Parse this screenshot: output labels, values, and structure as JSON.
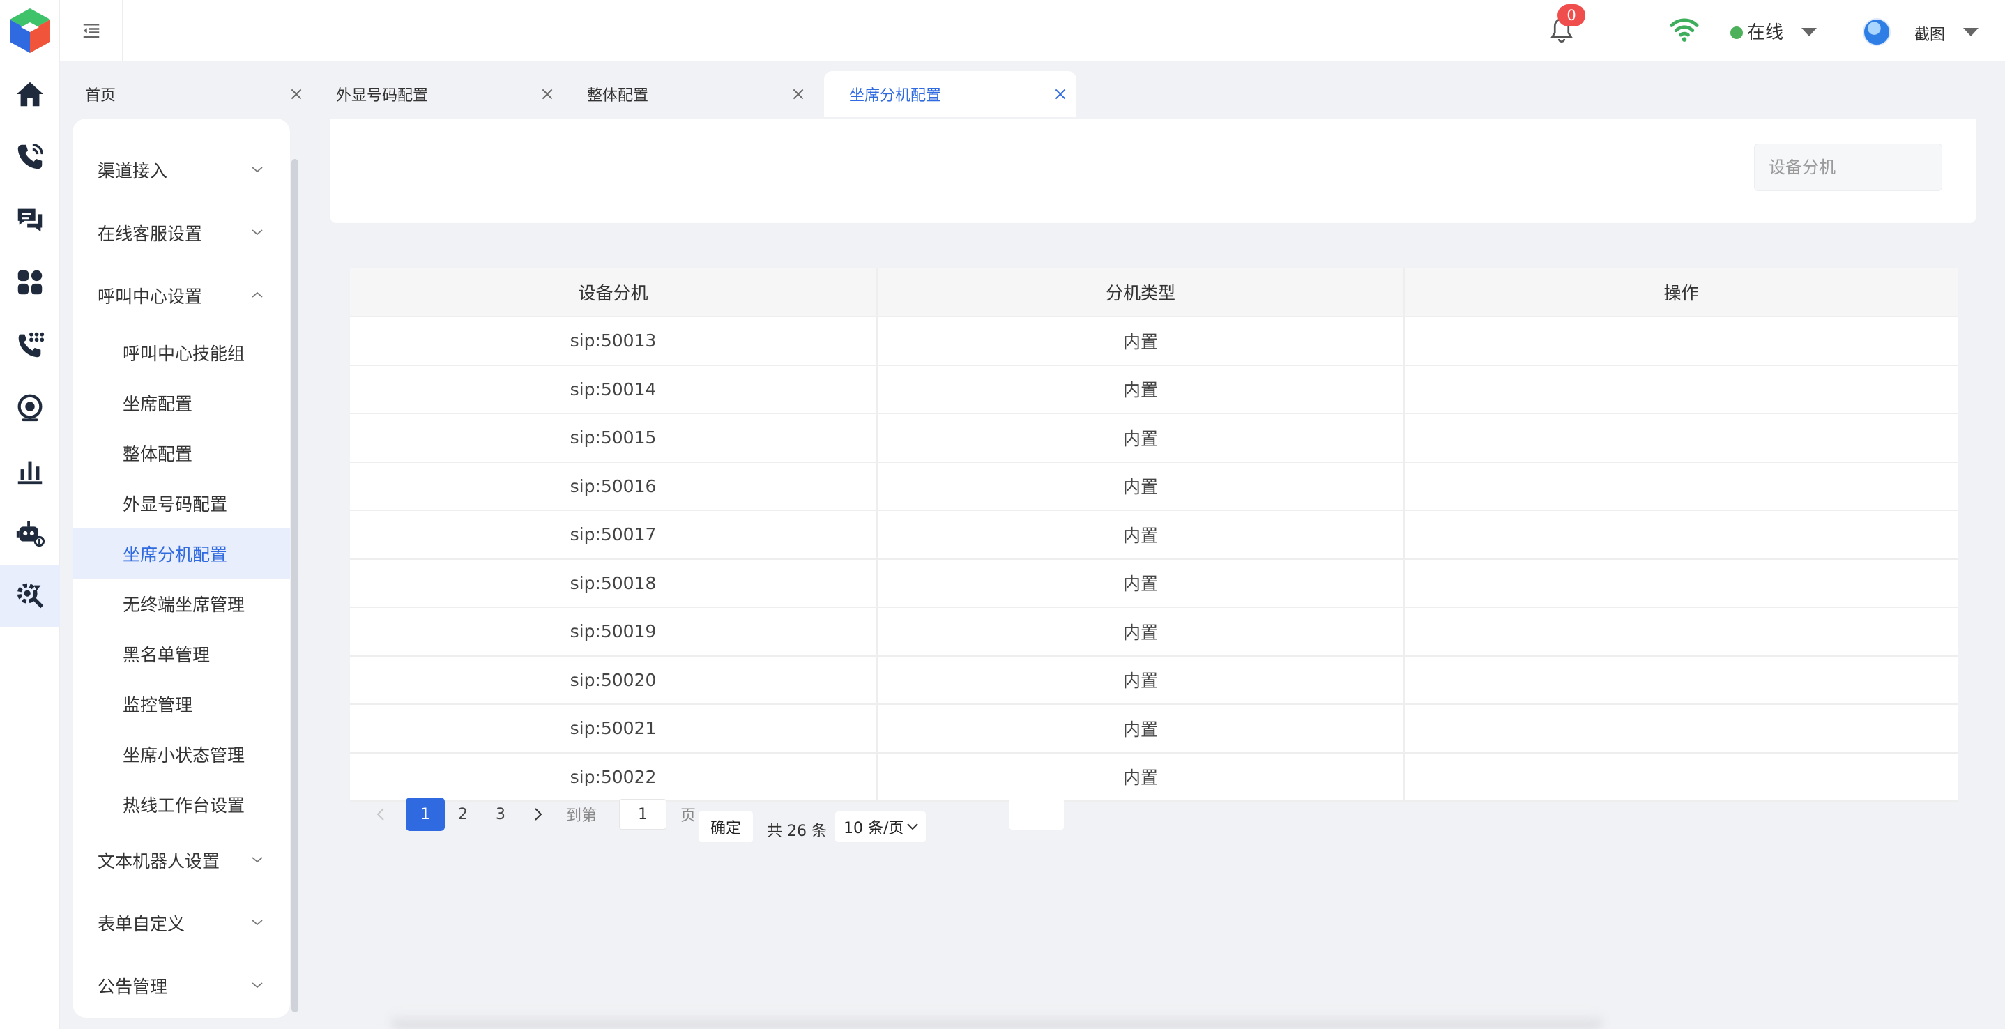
{
  "header": {
    "notification_count": "0",
    "status_label": "在线",
    "user_label": "截图"
  },
  "tabs": [
    {
      "label": "首页"
    },
    {
      "label": "外显号码配置"
    },
    {
      "label": "整体配置"
    },
    {
      "label": "坐席分机配置"
    }
  ],
  "menu": {
    "groups_top": [
      {
        "label": "渠道接入"
      },
      {
        "label": "在线客服设置"
      },
      {
        "label": "呼叫中心设置"
      }
    ],
    "sub_items": [
      {
        "label": "呼叫中心技能组"
      },
      {
        "label": "坐席配置"
      },
      {
        "label": "整体配置"
      },
      {
        "label": "外显号码配置"
      },
      {
        "label": "坐席分机配置"
      },
      {
        "label": "无终端坐席管理"
      },
      {
        "label": "黑名单管理"
      },
      {
        "label": "监控管理"
      },
      {
        "label": "坐席小状态管理"
      },
      {
        "label": "热线工作台设置"
      }
    ],
    "groups_bottom": [
      {
        "label": "文本机器人设置"
      },
      {
        "label": "表单自定义"
      },
      {
        "label": "公告管理"
      }
    ]
  },
  "filter": {
    "placeholder": "设备分机"
  },
  "table": {
    "columns": [
      "设备分机",
      "分机类型",
      "操作"
    ],
    "rows": [
      [
        "sip:50013",
        "内置",
        ""
      ],
      [
        "sip:50014",
        "内置",
        ""
      ],
      [
        "sip:50015",
        "内置",
        ""
      ],
      [
        "sip:50016",
        "内置",
        ""
      ],
      [
        "sip:50017",
        "内置",
        ""
      ],
      [
        "sip:50018",
        "内置",
        ""
      ],
      [
        "sip:50019",
        "内置",
        ""
      ],
      [
        "sip:50020",
        "内置",
        ""
      ],
      [
        "sip:50021",
        "内置",
        ""
      ],
      [
        "sip:50022",
        "内置",
        ""
      ]
    ]
  },
  "pagination": {
    "pages": [
      "1",
      "2",
      "3"
    ],
    "current_page": "1",
    "goto_label": "到第",
    "goto_value": "1",
    "page_unit": "页",
    "confirm_label": "确定",
    "total_label": "共 26 条",
    "page_size_label": "10 条/页"
  },
  "colors": {
    "accent": "#2f6ae0",
    "badge": "#f04d4d",
    "online": "#4cb15a"
  }
}
